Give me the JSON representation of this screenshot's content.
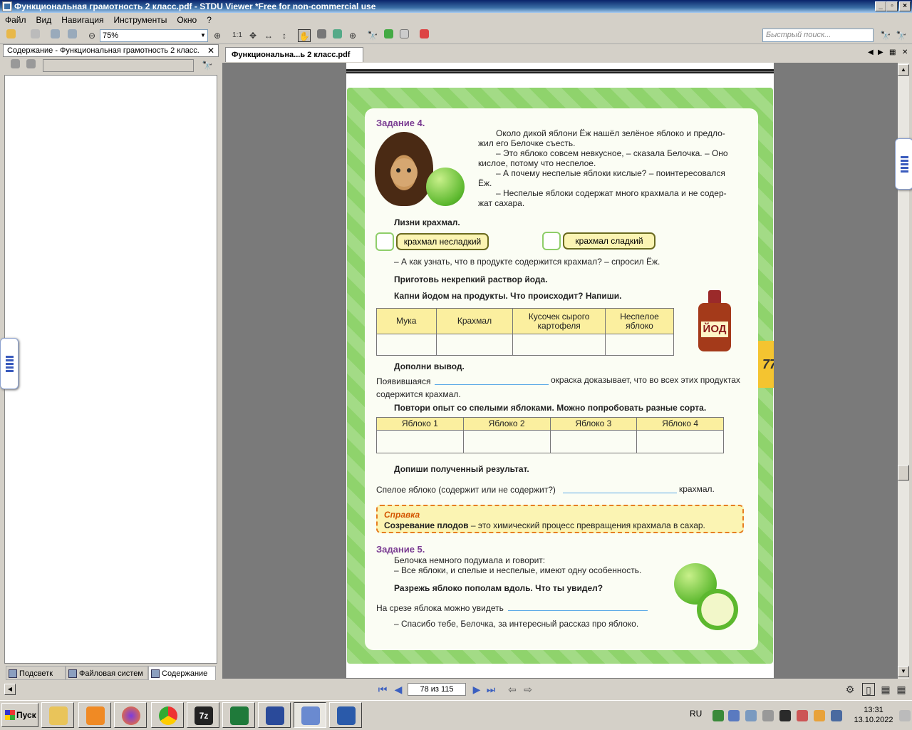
{
  "window": {
    "title": "Функциональная грамотность  2 класс.pdf - STDU Viewer *Free for non-commercial use"
  },
  "menu": [
    "Файл",
    "Вид",
    "Навигация",
    "Инструменты",
    "Окно",
    "?"
  ],
  "toolbar": {
    "zoom": "75%",
    "actual_size": "1:1",
    "search_placeholder": "Быстрый поиск..."
  },
  "left_panel": {
    "tab_title": "Содержание - Функциональная грамотность  2 класс.",
    "bottom_tabs": [
      "Подсветк",
      "Файловая систем",
      "Содержание"
    ]
  },
  "doc_tab": {
    "title": "Функциональна...ь  2 класс.pdf"
  },
  "page": {
    "task4_title": "Задание 4.",
    "story": [
      "Около дикой яблони Ёж нашёл зелёное яблоко и предло-",
      "жил его Белочке съесть.",
      "– Это яблоко совсем невкусное, – сказала Белочка. – Оно",
      "кислое, потому что неспелое.",
      "– А почему неспелые яблоки кислые? – поинтересовался",
      "Ёж.",
      "– Неспелые яблоки содержат много крахмала и не содер-",
      "жат сахара."
    ],
    "lick": "Лизни крахмал.",
    "option1": "крахмал несладкий",
    "option2": "крахмал сладкий",
    "question": "– А как узнать, что в продукте содержится крахмал? – спросил Ёж.",
    "prepare": "Приготовь некрепкий раствор йода.",
    "drip": "Капни йодом на продукты. Что происходит? Напиши.",
    "table1_headers": [
      "Мука",
      "Крахмал",
      "Кусочек сырого картофеля",
      "Неспелое яблоко"
    ],
    "iodine_label": "ЙОД",
    "conclusion_title": "Дополни вывод.",
    "conclusion_a": "Появившаяся",
    "conclusion_b": "окраска доказывает, что во всех этих продуктах",
    "conclusion_c": "содержится крахмал.",
    "repeat": "Повтори опыт со спелыми яблоками. Можно попробовать разные сорта.",
    "table2_headers": [
      "Яблоко 1",
      "Яблоко 2",
      "Яблоко 3",
      "Яблоко 4"
    ],
    "result_title": "Допиши полученный результат.",
    "result_a": "Спелое яблоко (содержит или не содержит?)",
    "result_b": "крахмал.",
    "spravka_title": "Справка",
    "spravka_bold": "Созревание плодов",
    "spravka_text": " – это химический процесс превращения крахмала в сахар.",
    "task5_title": "Задание 5.",
    "t5_line1": "Белочка немного подумала и говорит:",
    "t5_line2": "– Все яблоки, и спелые и неспелые, имеют одну особенность.",
    "t5_cut": "Разрежь яблоко пополам вдоль. Что ты увидел?",
    "t5_answer": "На срезе яблока можно увидеть",
    "t5_thanks": "– Спасибо тебе, Белочка, за интересный рассказ про яблоко.",
    "edge_number": "77"
  },
  "statusbar": {
    "page_indicator": "78 из 115"
  },
  "taskbar": {
    "start": "Пуск",
    "lang": "RU",
    "time": "13:31",
    "date": "13.10.2022"
  }
}
